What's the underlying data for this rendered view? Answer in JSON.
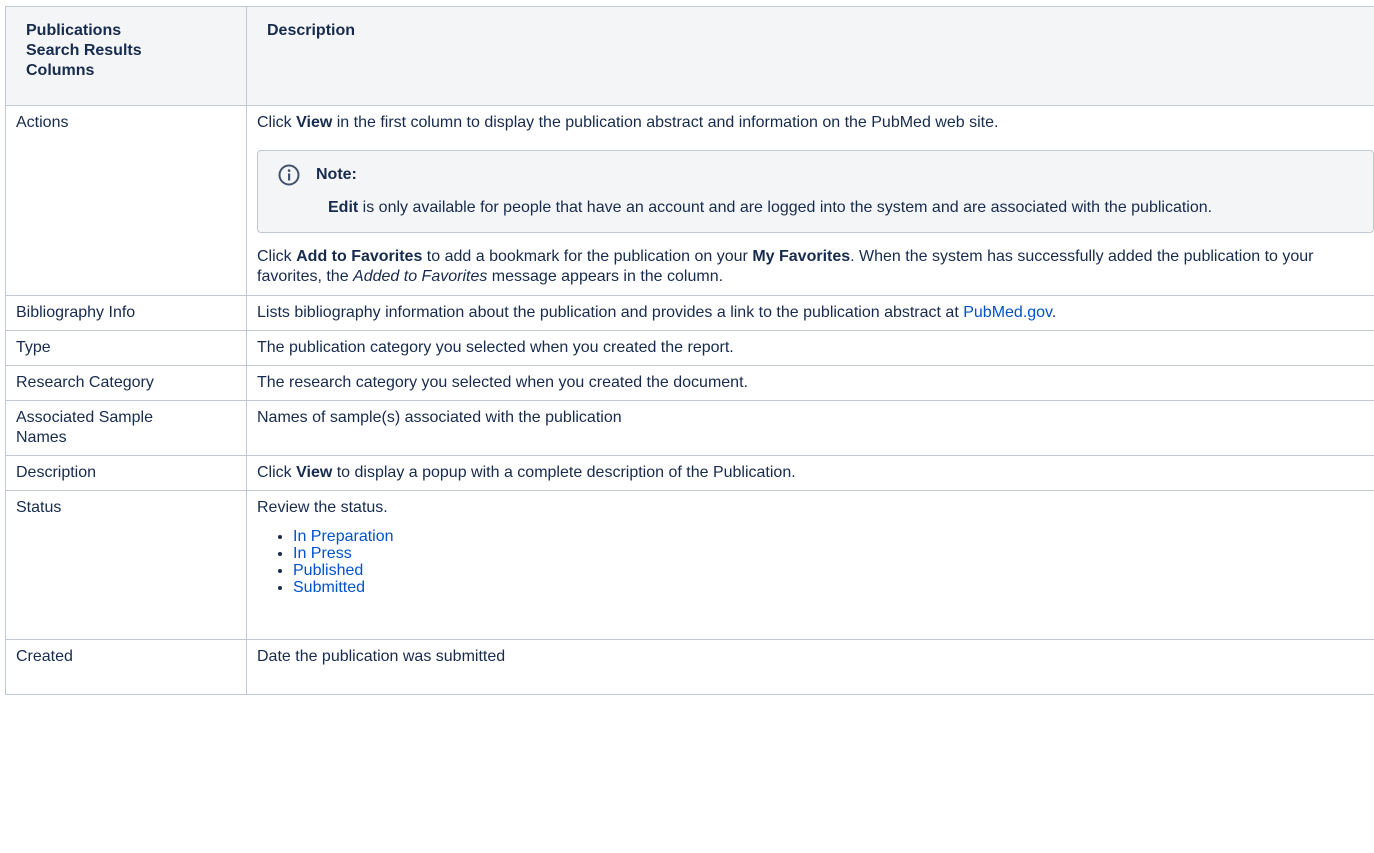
{
  "table": {
    "headers": [
      "Publications Search Results Columns",
      "Description"
    ],
    "rows": {
      "actions": {
        "label": "Actions",
        "p1_pre": "Click ",
        "p1_bold": "View",
        "p1_post": " in the first column to display the publication abstract and information on the PubMed web site.",
        "note_title": "Note:",
        "note_bold": "Edit",
        "note_text": " is only available for people that have an account and are logged into the system and are associated with the publication.",
        "p2_pre": "Click ",
        "p2_bold1": "Add to Favorites",
        "p2_mid": " to add a bookmark for the publication on your ",
        "p2_bold2": "My Favorites",
        "p2_mid2": ". When the system has successfully added the publication to your favorites, the ",
        "p2_italic": "Added to Favorites",
        "p2_post": " message appears in the column."
      },
      "bibliography": {
        "label": "Bibliography Info",
        "text_pre": "Lists bibliography information about the publication and provides a link to the publication abstract at ",
        "link": "PubMed.gov",
        "text_post": "."
      },
      "type": {
        "label": "Type",
        "text": "The publication category you selected when you created the report."
      },
      "research": {
        "label": "Research Category",
        "text": "The research category you selected when you created the document."
      },
      "samples": {
        "label": "Associated Sample Names",
        "text": "Names of sample(s) associated with the publication"
      },
      "description": {
        "label": "Description",
        "text_pre": "Click ",
        "bold": "View",
        "text_post": " to display a popup with a complete description of the Publication."
      },
      "status": {
        "label": "Status",
        "intro": "Review the status.",
        "items": [
          "In Preparation",
          "In Press",
          "Published",
          "Submitted"
        ]
      },
      "created": {
        "label": "Created",
        "text": "Date the publication was submitted"
      }
    }
  },
  "colors": {
    "link": "#0052cc",
    "border": "#c1c7d0",
    "header_bg": "#f4f5f7",
    "text": "#172b4d"
  },
  "icons": {
    "note": "info-icon"
  }
}
